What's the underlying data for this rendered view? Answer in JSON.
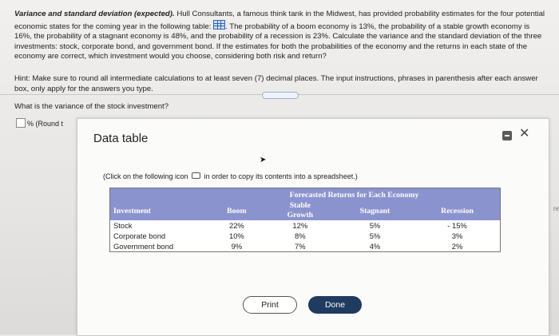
{
  "question": {
    "title": "Variance and standard deviation (expected).",
    "body_1": "Hull Consultants, a famous think tank in the Midwest, has provided probability estimates for the four potential economic states for the coming year in the following table:",
    "body_2": ". The probability of a boom economy is 13%, the probability of a stable growth economy is 16%, the probability of a stagnant economy is 48%, and the probability of a recession is 23%. Calculate the variance and the standard deviation of the three investments: stock, corporate bond, and government bond. If the estimates for both the probabilities of the economy and the returns in each state of the economy are correct, which investment would you choose, considering both risk and return?"
  },
  "hint": "Hint: Make sure to round all intermediate calculations to at least seven (7) decimal places. The input instructions, phrases in parenthesis after each answer box, only apply for the answers you type.",
  "sub_question": "What is the variance of the stock investment?",
  "answer_suffix": "% (Round t",
  "side_text": "re",
  "modal": {
    "title": "Data table",
    "copy_note_pre": "(Click on the following icon",
    "copy_note_post": "in order to copy its contents into a spreadsheet.)",
    "print_label": "Print",
    "done_label": "Done"
  },
  "table": {
    "group_header": "Forecasted Returns for Each Economy",
    "col_investment": "Investment",
    "col_boom": "Boom",
    "col_stable_1": "Stable",
    "col_stable_2": "Growth",
    "col_stagnant": "Stagnant",
    "col_recession": "Recession",
    "rows": [
      {
        "name": "Stock",
        "boom": "22%",
        "stable": "12%",
        "stagnant": "5%",
        "recession": "- 15%"
      },
      {
        "name": "Corporate bond",
        "boom": "10%",
        "stable": "8%",
        "stagnant": "5%",
        "recession": "3%"
      },
      {
        "name": "Government bond",
        "boom": "9%",
        "stable": "7%",
        "stagnant": "4%",
        "recession": "2%"
      }
    ]
  },
  "icons": {
    "table": "table-icon",
    "copy": "copy-icon",
    "minimize": "minimize-icon",
    "close": "close-icon",
    "cursor": "cursor-icon"
  },
  "colors": {
    "table_header": "#8b93cf",
    "done_button": "#1f3b5f"
  }
}
